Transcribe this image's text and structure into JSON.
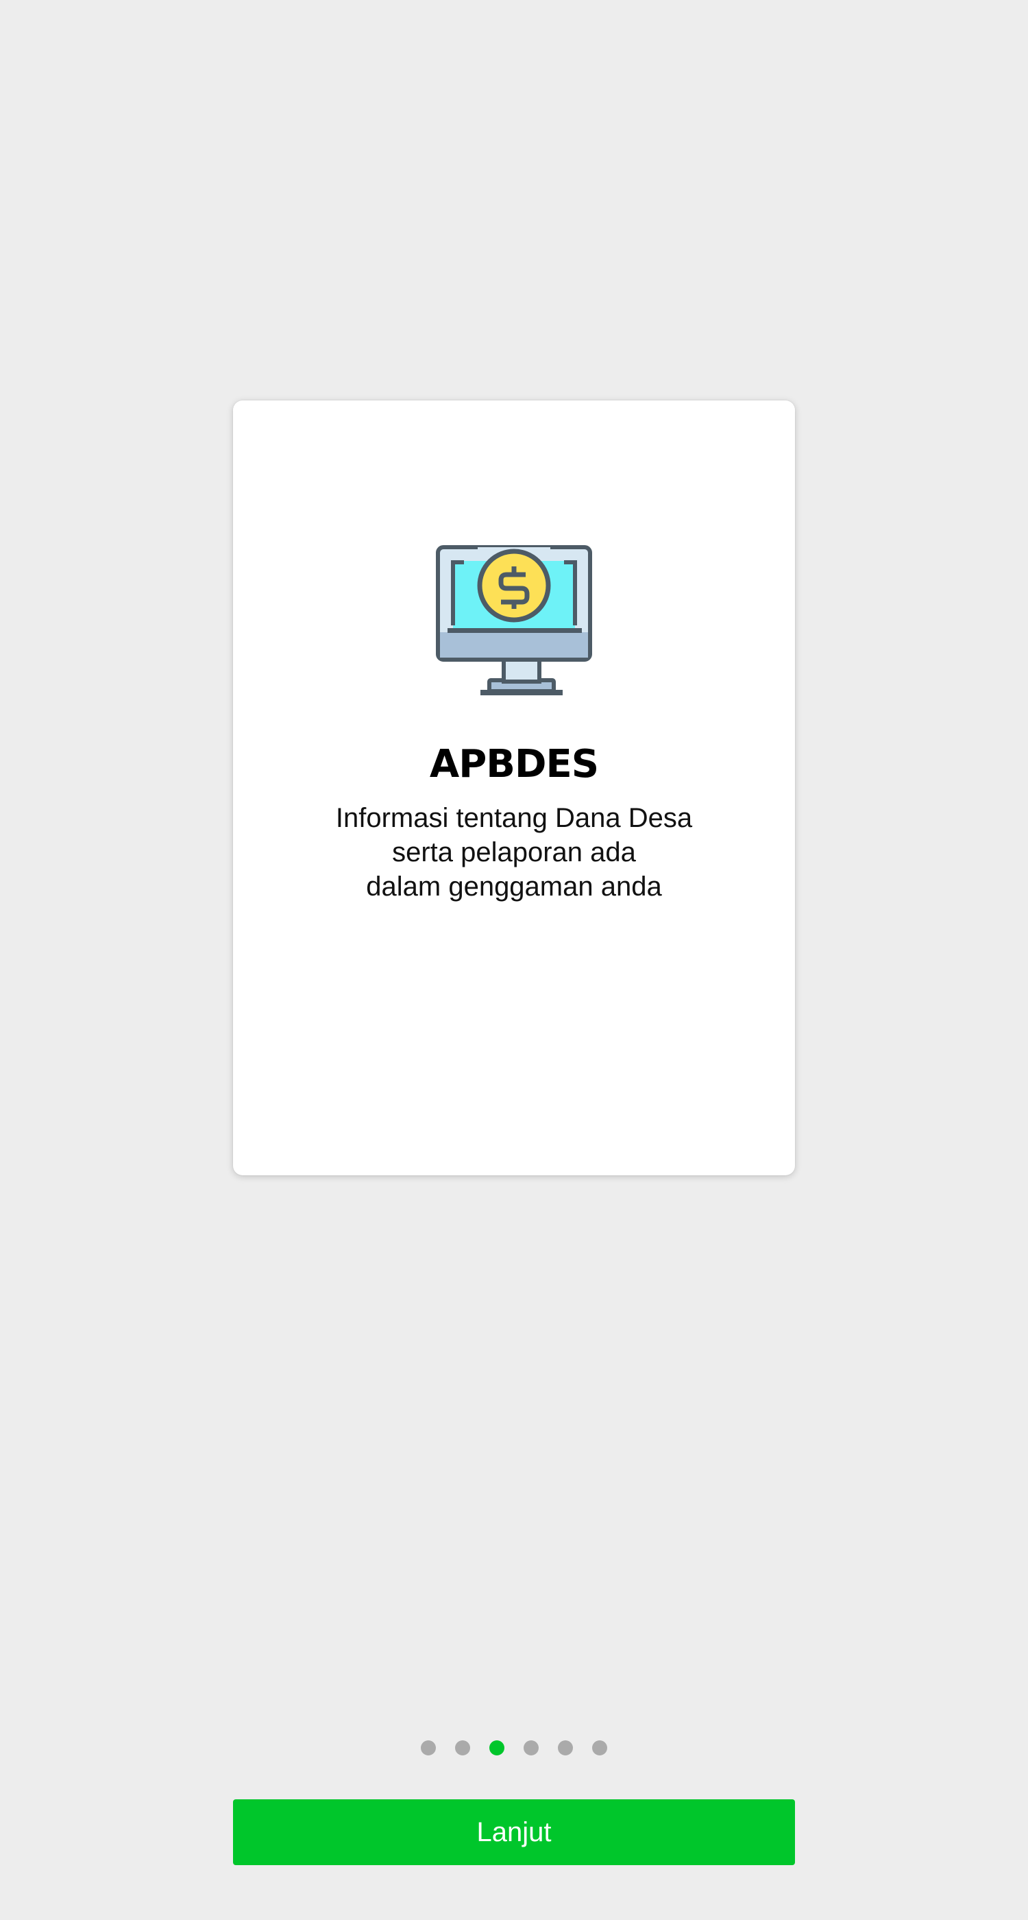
{
  "slide": {
    "icon": "monitor-dollar-icon",
    "title": "APBDES",
    "description": [
      "Informasi tentang Dana Desa",
      "serta pelaporan ada",
      "dalam genggaman anda"
    ]
  },
  "pager": {
    "count": 6,
    "active_index": 2
  },
  "next_button": {
    "label": "Lanjut"
  },
  "colors": {
    "background": "#ededed",
    "card": "#ffffff",
    "accent": "#00c62b",
    "dot_inactive": "#aaaaaa"
  }
}
